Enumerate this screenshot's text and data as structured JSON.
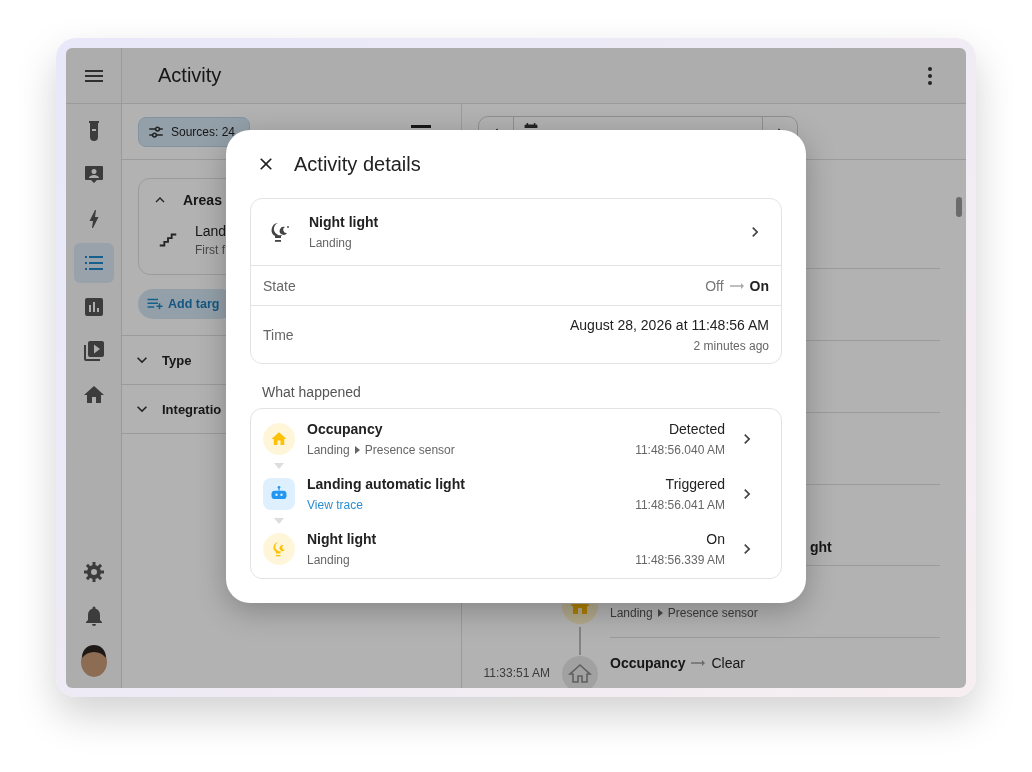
{
  "app_bar": {
    "title": "Activity"
  },
  "sidebar": {
    "items": [
      {
        "selected": false
      },
      {
        "selected": false
      },
      {
        "selected": false
      },
      {
        "selected": true
      },
      {
        "selected": false
      },
      {
        "selected": false
      },
      {
        "selected": false
      },
      {
        "selected": false
      },
      {
        "selected": false
      }
    ]
  },
  "filters": {
    "sources_chip": "Sources: 24",
    "sections": [
      {
        "title": "Areas",
        "expanded": true,
        "items": [
          {
            "name": "Land",
            "subtitle": "First f"
          }
        ],
        "add_button": "Add targ"
      },
      {
        "title": "Type",
        "expanded": false
      },
      {
        "title": "Integratio",
        "expanded": false
      }
    ]
  },
  "timeline": [
    {
      "title": "ght"
    },
    {
      "kind": "sensor",
      "active": true,
      "area": "Landing",
      "device": "Presence sensor"
    },
    {
      "kind": "sensor",
      "active": false,
      "time": "11:33:51 AM",
      "title": "Occupancy",
      "state": "Clear"
    }
  ],
  "dialog": {
    "title": "Activity details",
    "entity": {
      "name": "Night light",
      "area": "Landing"
    },
    "state": {
      "label": "State",
      "from": "Off",
      "to": "On"
    },
    "time": {
      "label": "Time",
      "value": "August 28, 2026 at 11:48:56 AM",
      "relative": "2 minutes ago"
    },
    "section_title": "What happened",
    "events": [
      {
        "kind": "sensor",
        "color": "#ffc107",
        "name": "Occupancy",
        "area": "Landing",
        "device": "Presence sensor",
        "state": "Detected",
        "time": "11:48:56.040 AM"
      },
      {
        "kind": "automation",
        "color": "#2196f3",
        "name": "Landing automatic light",
        "link": "View trace",
        "state": "Triggered",
        "time": "11:48:56.041 AM"
      },
      {
        "kind": "light",
        "color": "#ffc107",
        "name": "Night light",
        "area": "Landing",
        "state": "On",
        "time": "11:48:56.339 AM"
      }
    ]
  }
}
